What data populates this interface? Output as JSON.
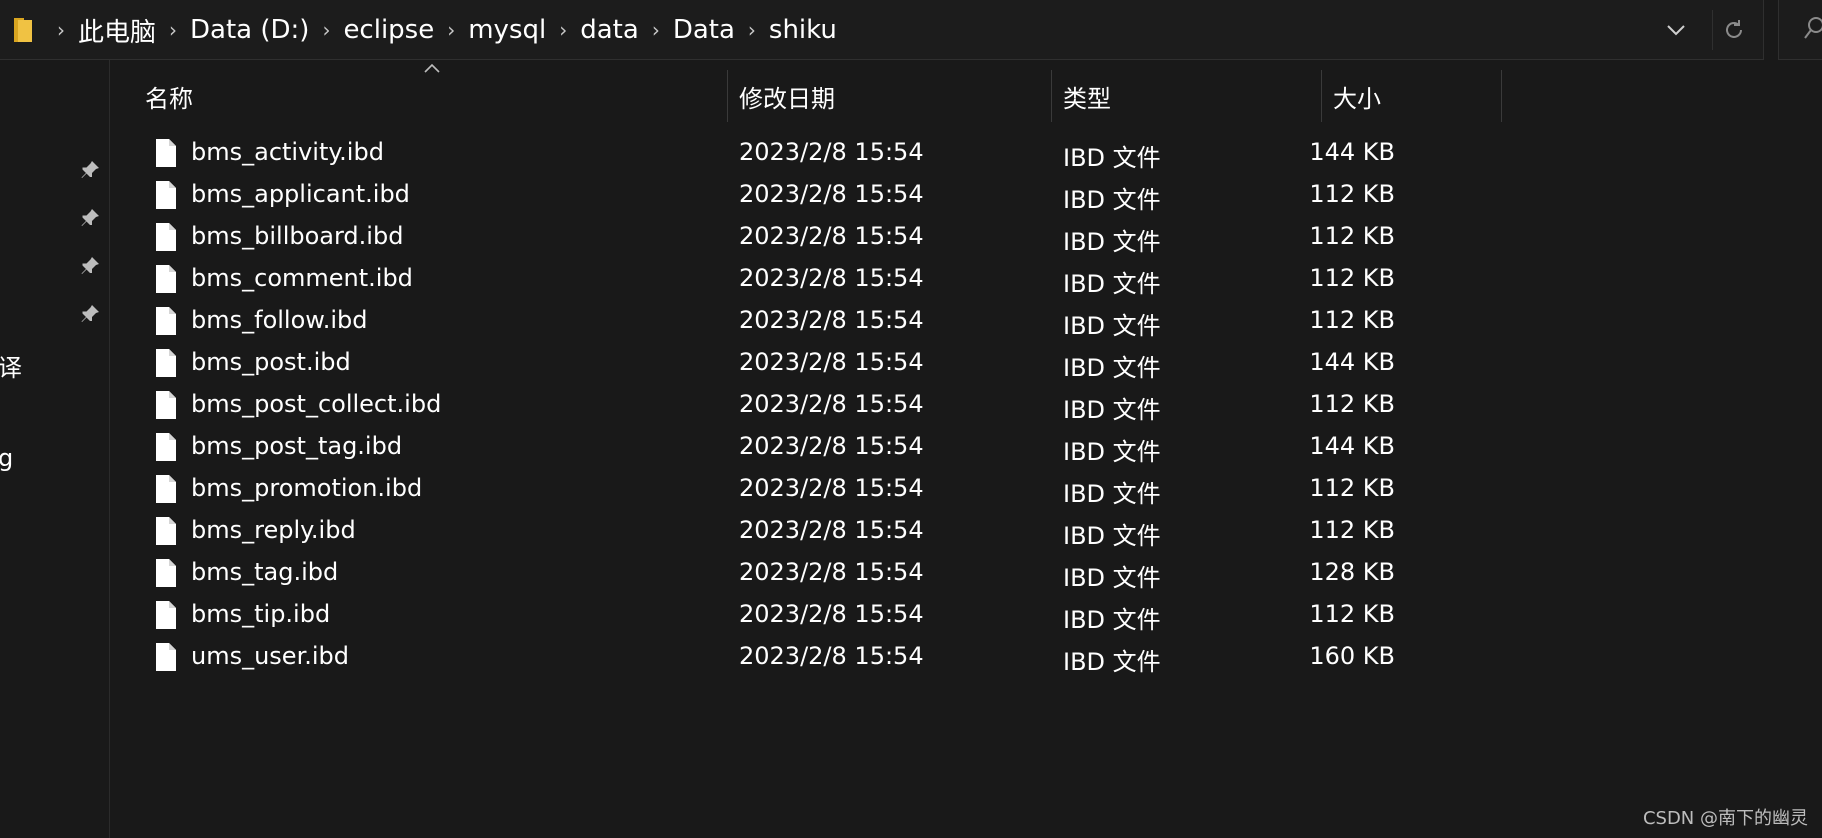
{
  "address_bar": {
    "folder_icon": "folder-icon",
    "breadcrumbs": [
      "此电脑",
      "Data (D:)",
      "eclipse",
      "mysql",
      "data",
      "Data",
      "shiku"
    ],
    "dropdown_icon": "chevron-down-icon",
    "refresh_icon": "refresh-icon"
  },
  "search": {
    "icon": "search-icon"
  },
  "nav_pane": {
    "pinned_icon": "pin-icon",
    "pinned_count": 4,
    "fragments": [
      "译",
      "g"
    ]
  },
  "columns": {
    "name": "名称",
    "modified": "修改日期",
    "type": "类型",
    "size": "大小"
  },
  "files": [
    {
      "name": "bms_activity.ibd",
      "modified": "2023/2/8 15:54",
      "type": "IBD 文件",
      "size": "144 KB"
    },
    {
      "name": "bms_applicant.ibd",
      "modified": "2023/2/8 15:54",
      "type": "IBD 文件",
      "size": "112 KB"
    },
    {
      "name": "bms_billboard.ibd",
      "modified": "2023/2/8 15:54",
      "type": "IBD 文件",
      "size": "112 KB"
    },
    {
      "name": "bms_comment.ibd",
      "modified": "2023/2/8 15:54",
      "type": "IBD 文件",
      "size": "112 KB"
    },
    {
      "name": "bms_follow.ibd",
      "modified": "2023/2/8 15:54",
      "type": "IBD 文件",
      "size": "112 KB"
    },
    {
      "name": "bms_post.ibd",
      "modified": "2023/2/8 15:54",
      "type": "IBD 文件",
      "size": "144 KB"
    },
    {
      "name": "bms_post_collect.ibd",
      "modified": "2023/2/8 15:54",
      "type": "IBD 文件",
      "size": "112 KB"
    },
    {
      "name": "bms_post_tag.ibd",
      "modified": "2023/2/8 15:54",
      "type": "IBD 文件",
      "size": "144 KB"
    },
    {
      "name": "bms_promotion.ibd",
      "modified": "2023/2/8 15:54",
      "type": "IBD 文件",
      "size": "112 KB"
    },
    {
      "name": "bms_reply.ibd",
      "modified": "2023/2/8 15:54",
      "type": "IBD 文件",
      "size": "112 KB"
    },
    {
      "name": "bms_tag.ibd",
      "modified": "2023/2/8 15:54",
      "type": "IBD 文件",
      "size": "128 KB"
    },
    {
      "name": "bms_tip.ibd",
      "modified": "2023/2/8 15:54",
      "type": "IBD 文件",
      "size": "112 KB"
    },
    {
      "name": "ums_user.ibd",
      "modified": "2023/2/8 15:54",
      "type": "IBD 文件",
      "size": "160 KB"
    }
  ],
  "watermark": "CSDN @南下的幽灵",
  "colors": {
    "background": "#191919",
    "text": "#ffffff",
    "folder_yellow": "#f0c243",
    "border": "#2f2f2f"
  }
}
